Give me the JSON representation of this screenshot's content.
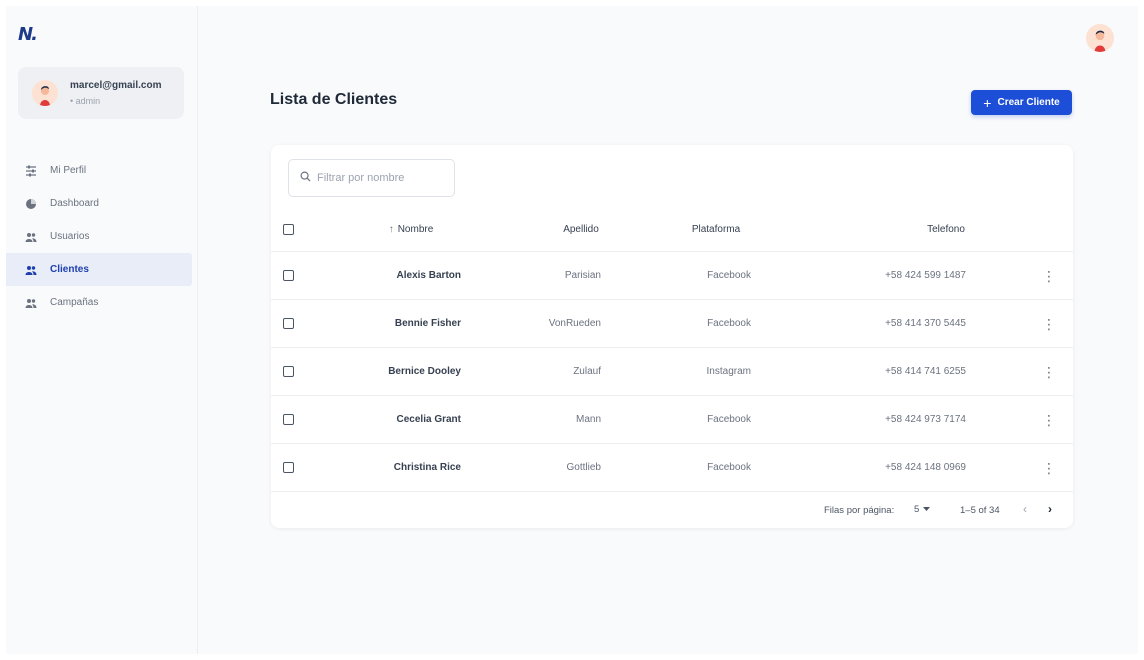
{
  "sidebar": {
    "logo": "N.",
    "user": {
      "email": "marcel@gmail.com",
      "role": "admin"
    },
    "items": [
      {
        "label": "Mi Perfil",
        "icon": "sliders-icon",
        "active": false
      },
      {
        "label": "Dashboard",
        "icon": "pie-chart-icon",
        "active": false
      },
      {
        "label": "Usuarios",
        "icon": "people-icon",
        "active": false
      },
      {
        "label": "Clientes",
        "icon": "people-icon",
        "active": true
      },
      {
        "label": "Campañas",
        "icon": "people-icon",
        "active": false
      }
    ]
  },
  "header": {
    "title": "Lista de Clientes",
    "create_button": "Crear Cliente"
  },
  "search": {
    "placeholder": "Filtrar por nombre"
  },
  "table": {
    "columns": {
      "sort_arrow": "↑",
      "nombre": "Nombre",
      "apellido": "Apellido",
      "plataforma": "Plataforma",
      "telefono": "Telefono"
    },
    "rows": [
      {
        "nombre": "Alexis Barton",
        "apellido": "Parisian",
        "plataforma": "Facebook",
        "telefono": "+58 424 599 1487"
      },
      {
        "nombre": "Bennie Fisher",
        "apellido": "VonRueden",
        "plataforma": "Facebook",
        "telefono": "+58 414 370 5445"
      },
      {
        "nombre": "Bernice Dooley",
        "apellido": "Zulauf",
        "plataforma": "Instagram",
        "telefono": "+58 414 741 6255"
      },
      {
        "nombre": "Cecelia Grant",
        "apellido": "Mann",
        "plataforma": "Facebook",
        "telefono": "+58 424 973 7174"
      },
      {
        "nombre": "Christina Rice",
        "apellido": "Gottlieb",
        "plataforma": "Facebook",
        "telefono": "+58 424 148 0969"
      }
    ]
  },
  "pagination": {
    "rows_label": "Filas por página:",
    "rows_value": "5",
    "range": "1–5 of 34"
  },
  "colors": {
    "accent": "#1d4ed8",
    "active_bg": "#e8edf8"
  }
}
